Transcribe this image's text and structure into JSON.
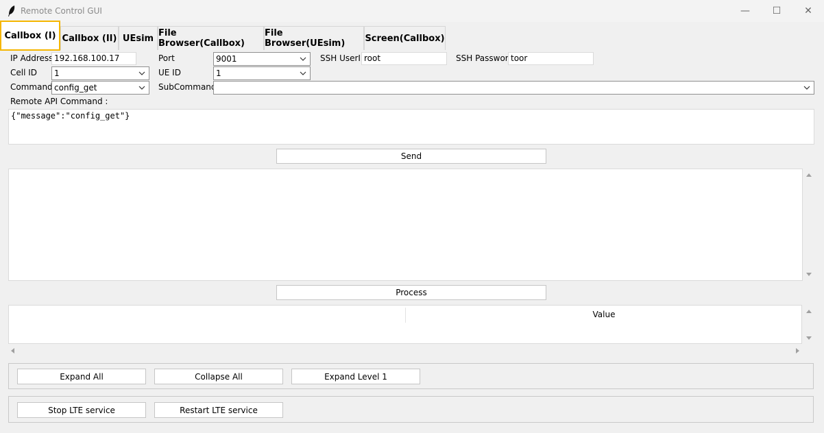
{
  "window": {
    "title": "Remote Control GUI",
    "controls": {
      "minimize": "—",
      "maximize": "☐",
      "close": "✕"
    }
  },
  "tabs": [
    {
      "label": "Callbox (I)",
      "active": true
    },
    {
      "label": "Callbox (II)",
      "active": false
    },
    {
      "label": "UEsim",
      "active": false
    },
    {
      "label": "File Browser(Callbox)",
      "active": false
    },
    {
      "label": "File Browser(UEsim)",
      "active": false
    },
    {
      "label": "Screen(Callbox)",
      "active": false
    }
  ],
  "form": {
    "ip": {
      "label": "IP Address",
      "value": "192.168.100.17"
    },
    "port": {
      "label": "Port",
      "value": "9001"
    },
    "ssh_user": {
      "label": "SSH UserID",
      "value": "root"
    },
    "ssh_pass": {
      "label": "SSH Password",
      "value": "toor"
    },
    "cell": {
      "label": "Cell ID",
      "value": "1"
    },
    "ue": {
      "label": "UE ID",
      "value": "1"
    },
    "command": {
      "label": "Command",
      "value": "config_get"
    },
    "subcommand": {
      "label": "SubCommand",
      "value": ""
    }
  },
  "api": {
    "label": "Remote API Command :",
    "value": "{\"message\":\"config_get\"}"
  },
  "buttons": {
    "send": "Send",
    "process": "Process",
    "expand_all": "Expand All",
    "collapse_all": "Collapse All",
    "expand_level1": "Expand Level 1",
    "stop_lte": "Stop LTE service",
    "restart_lte": "Restart LTE service"
  },
  "tree": {
    "col1": "",
    "col2": "Value"
  },
  "colors": {
    "active_tab_border": "#f5b600",
    "background": "#f0f0f0"
  }
}
